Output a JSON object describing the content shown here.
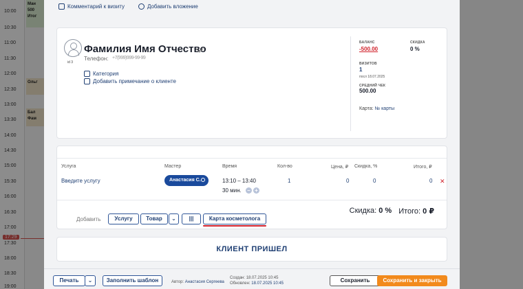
{
  "calendar": {
    "times": [
      "10:00",
      "10:30",
      "11:00",
      "11:30",
      "12:00",
      "12:30",
      "13:00",
      "13:30",
      "14:00",
      "14:30",
      "15:00",
      "15:30",
      "16:00",
      "16:30",
      "17:00",
      "17:30",
      "18:00",
      "18:30",
      "19:00"
    ],
    "now": "17:29",
    "events": [
      {
        "label": "Ман 500 Итог",
        "color": "#dcefd3"
      },
      {
        "label": "Ольг",
        "color": "#f1e4c8"
      },
      {
        "label": "Бал Фам",
        "color": "#f1e4c8"
      }
    ]
  },
  "top_links": {
    "comment": "Комментарий к визиту",
    "attachment": "Добавить вложение"
  },
  "client": {
    "id": "id 3",
    "name": "Фамилия Имя Отчество",
    "phone_label": "Телефон:",
    "phone_value": "+7(999)999-99-99",
    "category_link": "Категория",
    "note_link": "Добавить примечание о клиенте",
    "balance_label": "БАЛАНС",
    "balance_value": "-500.00",
    "discount_label": "СКИДКА",
    "discount_value": "0 %",
    "visits_label": "ВИЗИТОВ",
    "visits_value": "1",
    "last_visit": "посл 18.07.2025",
    "avg_check_label": "СРЕДНИЙ ЧЕК",
    "avg_check_value": "500.00",
    "card_label": "Карта:",
    "card_link": "№ карты"
  },
  "services": {
    "headers": {
      "service": "Услуга",
      "master": "Мастер",
      "time": "Время",
      "qty": "Кол-во",
      "price": "Цена, ₽",
      "discount": "Скидка, %",
      "total": "Итого, ₽"
    },
    "row": {
      "service": "Введите услугу",
      "master": "Анастасия С.",
      "time": "13:10 – 13:40",
      "duration": "30 мин.",
      "qty": "1",
      "price": "0",
      "discount": "0",
      "total": "0"
    },
    "add_label": "Добавить",
    "btn_service": "Услугу",
    "btn_product": "Товар",
    "btn_cosmo": "Карта косметолога",
    "totals_discount_label": "Скидка:",
    "totals_discount_value": "0 %",
    "totals_total_label": "Итого:",
    "totals_total_value": "0 ₽"
  },
  "arrived_button": "КЛИЕНТ ПРИШЕЛ",
  "footer": {
    "print": "Печать",
    "fill_template": "Заполнить шаблон",
    "author_label": "Автор:",
    "author_value": "Анастасия Сергеева",
    "created_label": "Создан:",
    "created_value": "18.07.2025 10:45",
    "updated_label": "Обновлен:",
    "updated_value": "18.07.2025 10:45",
    "save": "Сохранить",
    "save_close": "Сохранить и закрыть"
  },
  "colors": {
    "accent": "#1a4a9c",
    "danger": "#d0202a",
    "primary_action": "#f28a1c"
  }
}
